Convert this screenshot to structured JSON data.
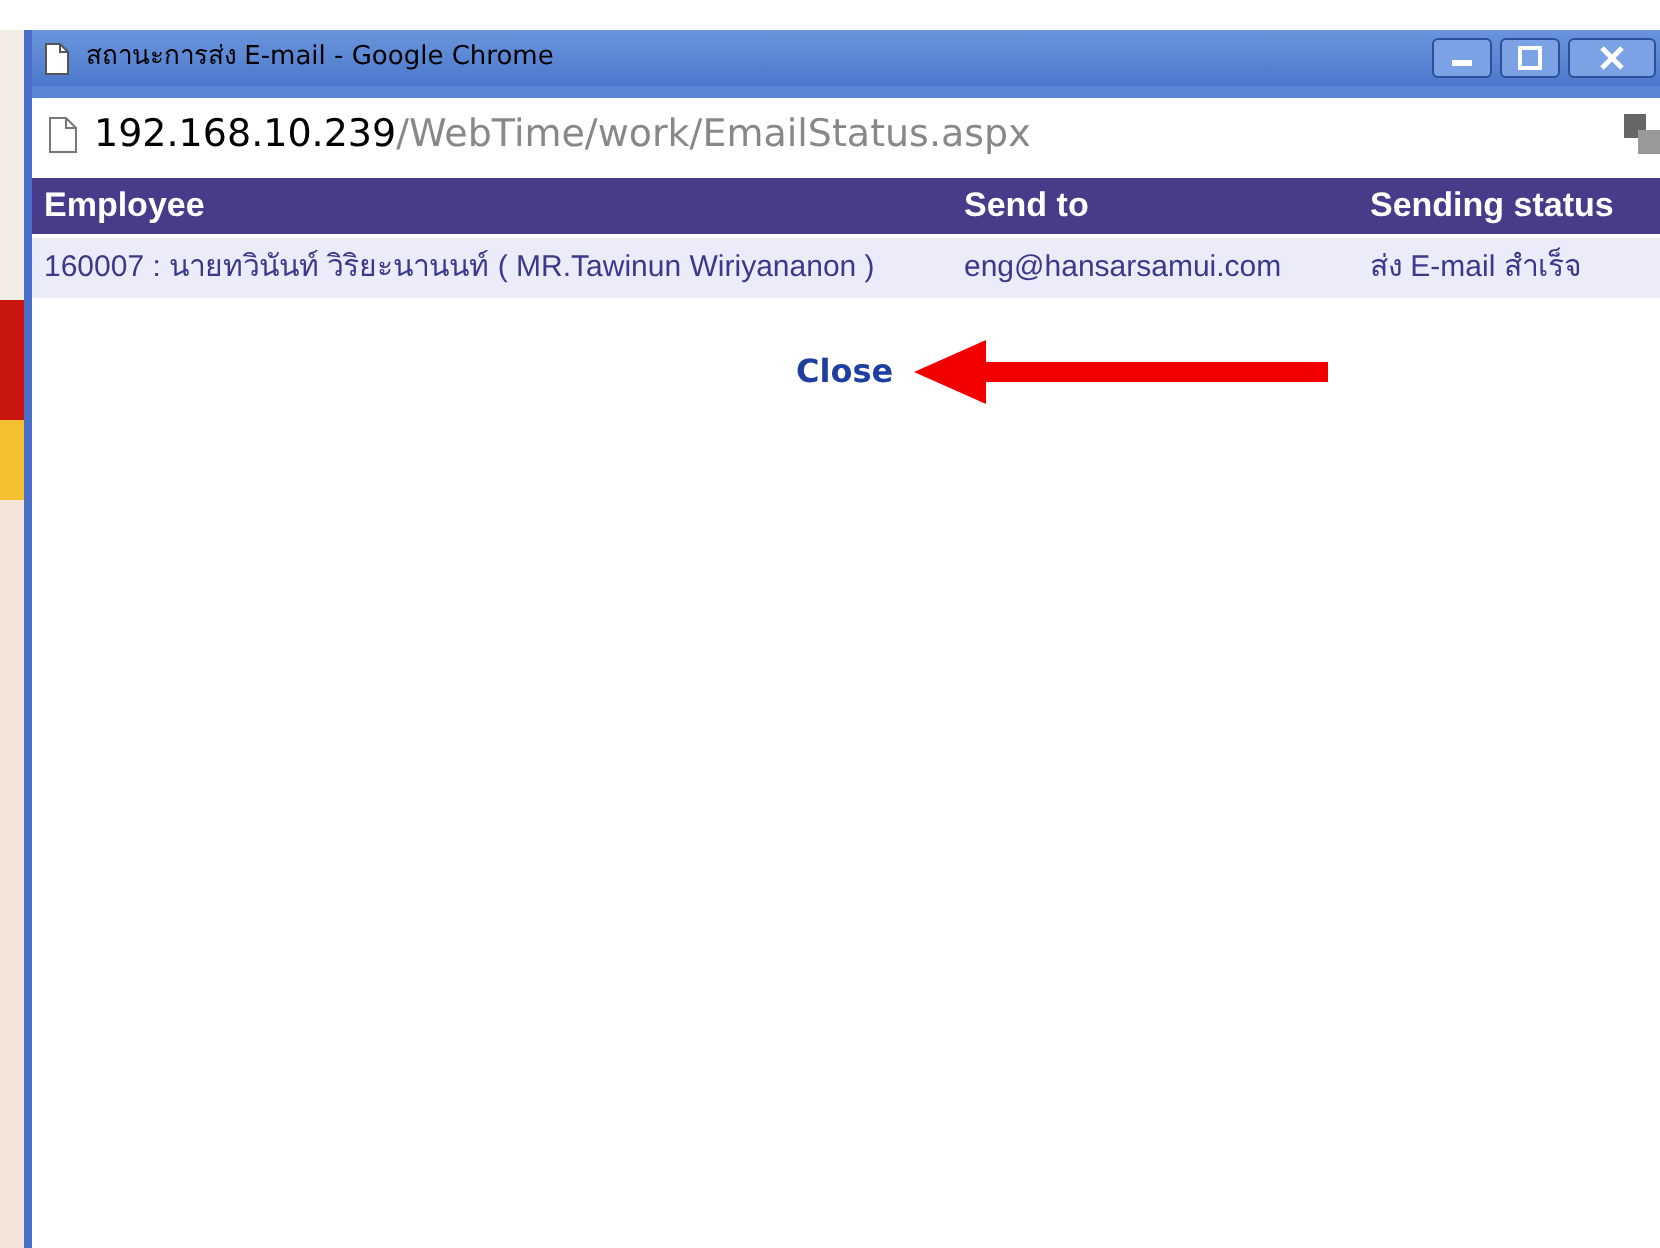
{
  "window": {
    "title": "สถานะการส่ง E-mail - Google Chrome"
  },
  "address_bar": {
    "host": "192.168.10.239",
    "path": "/WebTime/work/EmailStatus.aspx"
  },
  "table": {
    "columns": [
      "Employee",
      "Send to",
      "Sending status"
    ],
    "rows": [
      {
        "employee": "160007 : นายทวินันท์ วิริยะนานนท์ ( MR.Tawinun Wiriyananon )",
        "send_to": "eng@hansarsamui.com",
        "status": "ส่ง E-mail สำเร็จ"
      }
    ]
  },
  "close_link": "Close"
}
